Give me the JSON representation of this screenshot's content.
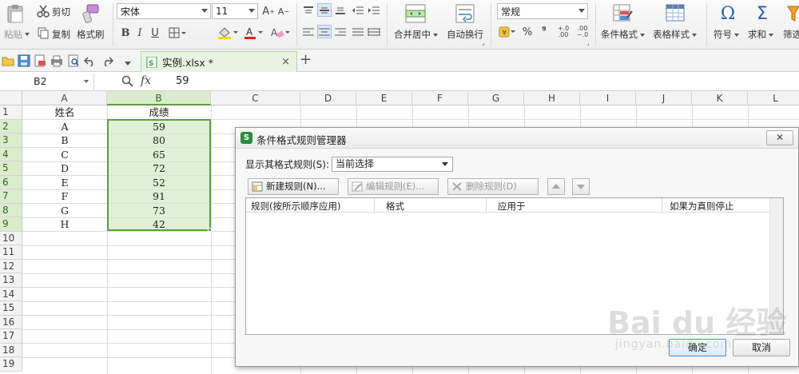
{
  "ribbon": {
    "paste_label": "粘贴",
    "cut_label": "剪切",
    "copy_label": "复制",
    "format_painter_label": "格式刷",
    "font_name": "宋体",
    "font_size": "11",
    "bold_glyph": "B",
    "italic_glyph": "I",
    "underline_glyph": "U",
    "merge_center_label": "合并居中",
    "wrap_text_label": "自动换行",
    "number_format": "常规",
    "percent_glyph": "%",
    "comma_glyph": "⁹",
    "cond_format_label": "条件格式",
    "table_style_label": "表格样式",
    "symbol_label": "符号",
    "sum_label": "求和",
    "filter_label": "筛选",
    "omega_glyph": "Ω",
    "sigma_glyph": "Σ"
  },
  "tabbar": {
    "doc_tab_title": "实例.xlsx *",
    "close_glyph": "×",
    "new_tab_glyph": "+"
  },
  "formula_bar": {
    "name_box": "B2",
    "fx_label": "fx",
    "formula_value": "59"
  },
  "grid": {
    "columns": [
      "A",
      "B",
      "C",
      "D",
      "E",
      "F",
      "G",
      "H",
      "I",
      "J",
      "K",
      "L"
    ],
    "row_numbers": [
      "1",
      "2",
      "3",
      "4",
      "5",
      "6",
      "7",
      "8",
      "9",
      "10",
      "11",
      "12",
      "13",
      "14",
      "15",
      "16",
      "17",
      "18",
      "19"
    ],
    "header_name": "姓名",
    "header_score": "成绩",
    "rows": [
      {
        "name": "A",
        "score": "59"
      },
      {
        "name": "B",
        "score": "80"
      },
      {
        "name": "C",
        "score": "65"
      },
      {
        "name": "D",
        "score": "72"
      },
      {
        "name": "E",
        "score": "52"
      },
      {
        "name": "F",
        "score": "91"
      },
      {
        "name": "G",
        "score": "73"
      },
      {
        "name": "H",
        "score": "42"
      }
    ]
  },
  "dialog": {
    "title": "条件格式规则管理器",
    "logo_glyph": "S",
    "close_glyph": "✕",
    "show_rules_label": "显示其格式规则(S):",
    "show_rules_value": "当前选择",
    "new_rule_label": "新建规则(N)...",
    "edit_rule_label": "编辑规则(E)...",
    "delete_rule_label": "删除规则(D)",
    "col_rule": "规则(按所示顺序应用)",
    "col_format": "格式",
    "col_applies_to": "应用于",
    "col_stop_if_true": "如果为真则停止",
    "ok_label": "确定",
    "cancel_label": "取消"
  },
  "watermark": {
    "logo_text": "Bai du 经验",
    "url_text": "jingyan.baidu.com"
  },
  "colors": {
    "selection_green": "#5c9e3d",
    "selection_fill": "#dbeccd",
    "primary_button_border": "#4a8fd6"
  }
}
